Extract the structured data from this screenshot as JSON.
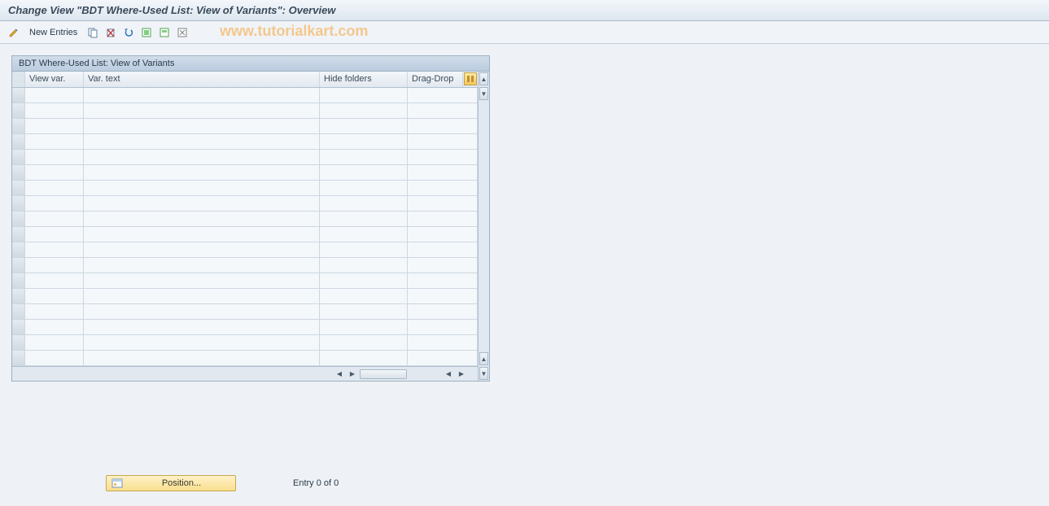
{
  "title": "Change View \"BDT Where-Used List: View of Variants\": Overview",
  "toolbar": {
    "new_entries_label": "New Entries"
  },
  "watermark": "www.tutorialkart.com",
  "panel": {
    "header": "BDT Where-Used List: View of Variants",
    "columns": {
      "view_var": "View var.",
      "var_text": "Var. text",
      "hide_folders": "Hide folders",
      "drag_drop": "Drag-Drop"
    },
    "rows": [
      "",
      "",
      "",
      "",
      "",
      "",
      "",
      "",
      "",
      "",
      "",
      "",
      "",
      "",
      "",
      "",
      "",
      ""
    ]
  },
  "footer": {
    "position_label": "Position...",
    "entry_status": "Entry 0 of 0"
  }
}
